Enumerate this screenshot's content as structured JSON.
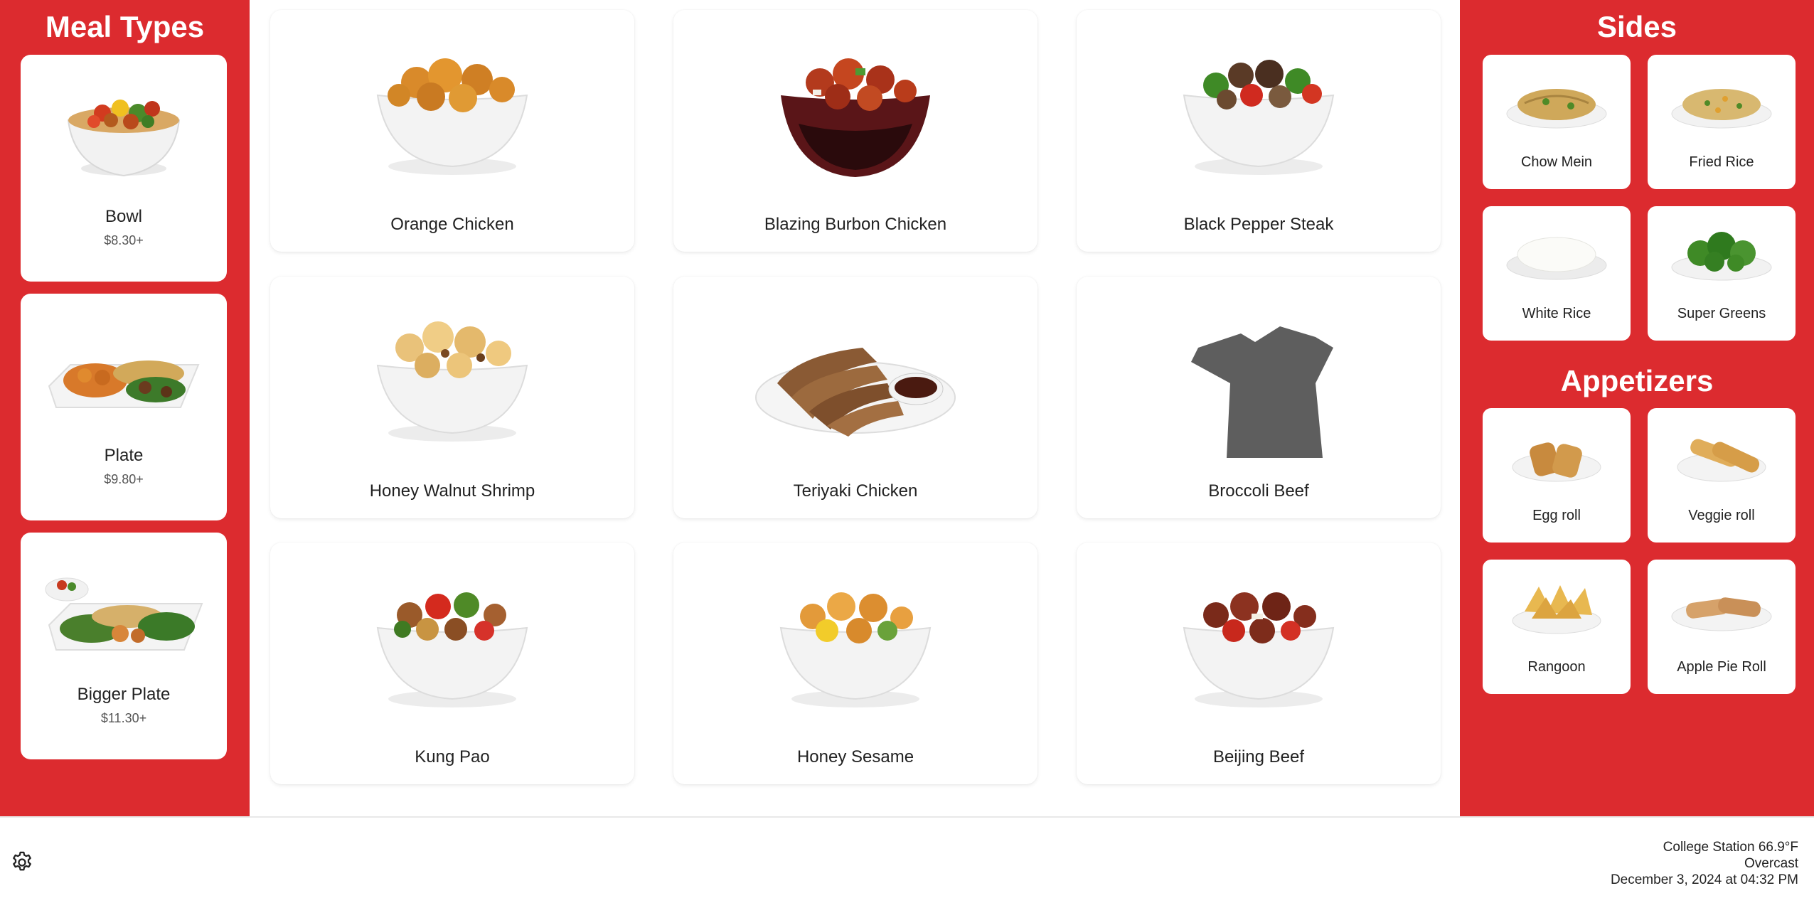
{
  "meal_types": {
    "title": "Meal Types",
    "items": [
      {
        "name": "Bowl",
        "price": "$8.30+"
      },
      {
        "name": "Plate",
        "price": "$9.80+"
      },
      {
        "name": "Bigger Plate",
        "price": "$11.30+"
      }
    ]
  },
  "entrees": [
    {
      "name": "Orange Chicken",
      "icon": "orange-chicken-bowl-image"
    },
    {
      "name": "Blazing Burbon Chicken",
      "icon": "blazing-bourbon-chicken-image"
    },
    {
      "name": "Black Pepper Steak",
      "icon": "black-pepper-steak-image"
    },
    {
      "name": "Honey Walnut Shrimp",
      "icon": "honey-walnut-shrimp-image"
    },
    {
      "name": "Teriyaki Chicken",
      "icon": "teriyaki-chicken-image"
    },
    {
      "name": "Broccoli Beef",
      "icon": "takeout-box-icon"
    },
    {
      "name": "Kung Pao",
      "icon": "kung-pao-image"
    },
    {
      "name": "Honey Sesame",
      "icon": "honey-sesame-image"
    },
    {
      "name": "Beijing Beef",
      "icon": "beijing-beef-image"
    }
  ],
  "sides": {
    "title": "Sides",
    "items": [
      {
        "name": "Chow Mein"
      },
      {
        "name": "Fried Rice"
      },
      {
        "name": "White Rice"
      },
      {
        "name": "Super Greens"
      }
    ]
  },
  "appetizers": {
    "title": "Appetizers",
    "items": [
      {
        "name": "Egg roll"
      },
      {
        "name": "Veggie roll"
      },
      {
        "name": "Rangoon"
      },
      {
        "name": "Apple Pie Roll"
      }
    ]
  },
  "footer": {
    "settings_icon": "gear-icon",
    "weather_line1": "College Station 66.9°F",
    "weather_line2": "Overcast",
    "datetime": "December 3, 2024 at 04:32 PM"
  },
  "colors": {
    "brand_red": "#dc2b2f",
    "card_bg": "#ffffff"
  }
}
